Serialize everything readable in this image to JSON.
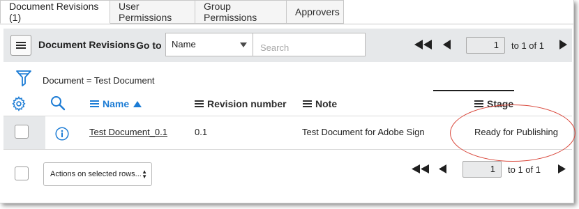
{
  "tabs": [
    {
      "label": "Document Revisions (1)",
      "active": true
    },
    {
      "label": "User Permissions",
      "active": false
    },
    {
      "label": "Group Permissions",
      "active": false
    },
    {
      "label": "Approvers",
      "active": false
    }
  ],
  "header": {
    "title": "Document Revisions",
    "goto_label": "Go to",
    "goto_selected": "Name",
    "search_placeholder": "Search",
    "page_value": "1",
    "page_of": "to 1 of 1"
  },
  "filter": {
    "breadcrumb": "Document = Test Document"
  },
  "columns": [
    {
      "label": "Name",
      "sorted": "ascending"
    },
    {
      "label": "Revision number"
    },
    {
      "label": "Note"
    },
    {
      "label": "Stage"
    }
  ],
  "rows": [
    {
      "name": "Test Document_0.1",
      "revision_number": "0.1",
      "note": "Test Document for Adobe Sign",
      "stage": "Ready for Publishing"
    }
  ],
  "footer": {
    "actions_label": "Actions on selected rows...",
    "page_value": "1",
    "page_of": "to 1 of 1"
  },
  "colors": {
    "accent_blue": "#1c7cd5",
    "header_bg": "#e6e8ea",
    "annotation_red": "#d9473b"
  },
  "icons": [
    "hamburger-menu-icon",
    "dropdown-caret-icon",
    "first-page-icon",
    "previous-page-icon",
    "next-page-icon",
    "filter-funnel-icon",
    "gear-icon",
    "search-icon",
    "column-menu-icon",
    "sort-ascending-icon",
    "info-icon"
  ]
}
